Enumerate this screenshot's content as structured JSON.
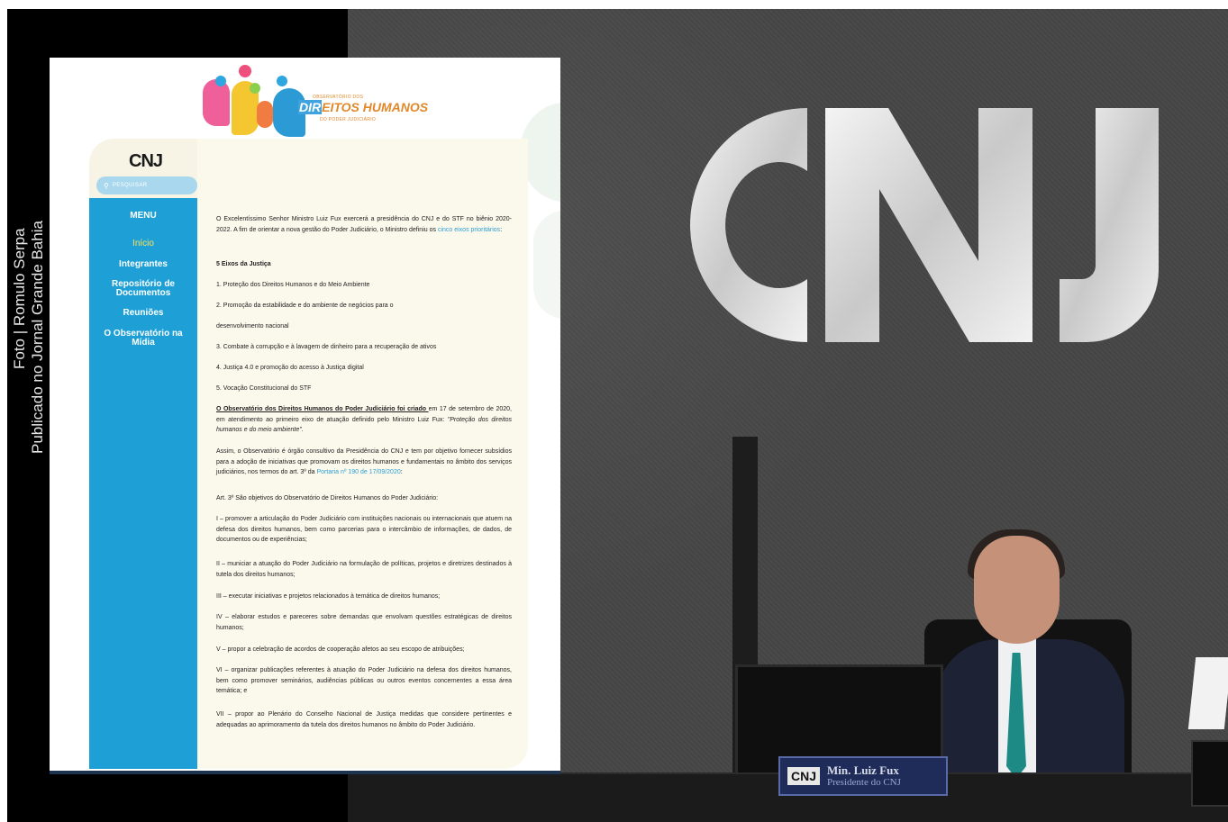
{
  "credit": {
    "line1": "Foto | Romulo Serpa",
    "line2": "Publicado no Jornal Grande Bahia"
  },
  "photo": {
    "big_logo": "CNJ",
    "nameplate_logo": "CNJ",
    "nameplate_name": "Min. Luiz Fux",
    "nameplate_role": "Presidente do CNJ"
  },
  "site": {
    "logo": {
      "top_text": "OBSERVATÓRIO DOS",
      "main_text_a": "DIR",
      "main_text_b": "EITOS HUMANOS",
      "bottom_text": "DO PODER JUDICIÁRIO"
    },
    "cnj_logo": "CNJ",
    "search": {
      "icon": "search-icon",
      "placeholder": "PESQUISAR"
    },
    "menu": {
      "title": "MENU",
      "items": [
        {
          "label": "Início",
          "active": true
        },
        {
          "label": "Integrantes"
        },
        {
          "label": "Repositório de"
        },
        {
          "label": "Documentos"
        },
        {
          "label": "Reuniões"
        },
        {
          "label": "O Observatório na"
        },
        {
          "label": "Mídia"
        }
      ]
    },
    "content": {
      "intro_a": "O Excelentíssimo Senhor Ministro Luiz Fux exercerá a presidência do CNJ e do STF no biênio 2020-2022. A fim de orientar a nova gestão do Poder Judiciário, o Ministro definiu os ",
      "intro_link": "cinco eixos prioritários",
      "intro_b": ":",
      "eixos_title": "5 Eixos da Justiça",
      "eixo1": "1. Proteção dos Direitos Humanos e do Meio Ambiente",
      "eixo2a": "2. Promoção da estabilidade e do ambiente de negócios para o",
      "eixo2b": "desenvolvimento nacional",
      "eixo3": "3. Combate à corrupção e à lavagem de dinheiro para a recuperação de ativos",
      "eixo4": "4. Justiça 4.0 e promoção do acesso à Justiça digital",
      "eixo5": "5. Vocação Constitucional do STF",
      "created_bold": "O Observatório dos Direitos Humanos do Poder Judiciário foi criado ",
      "created_rest": "em 17 de setembro de 2020, em atendimento ao primeiro eixo de atuação definido pelo Ministro Luiz Fux: ",
      "created_quote": "\"Proteção dos direitos humanos e do meio ambiente\".",
      "assim_a": "Assim, o Observatório é órgão consultivo da Presidência do CNJ e tem por objetivo fornecer subsídios para a adoção de iniciativas que promovam os direitos humanos e fundamentais no âmbito dos serviços judiciários, nos termos do art. 3º da ",
      "assim_link": "Portaria nº 190 de 17/09/2020",
      "assim_b": ":",
      "art3": "Art. 3º São objetivos do Observatório de Direitos Humanos do Poder Judiciário:",
      "obj1": "I – promover a articulação do Poder Judiciário com instituições nacionais ou internacionais que atuem na defesa dos direitos humanos, bem como parcerias para o intercâmbio de informações, de dados, de documentos ou de experiências;",
      "obj2": "II – municiar a atuação do Poder Judiciário na formulação de políticas, projetos e diretrizes destinados à tutela dos direitos humanos;",
      "obj3": "III – executar iniciativas e projetos relacionados à temática de direitos humanos;",
      "obj4": "IV – elaborar estudos e pareceres sobre demandas que envolvam questões estratégicas de direitos humanos;",
      "obj5": "V – propor a celebração de acordos de cooperação afetos ao seu escopo de atribuições;",
      "obj6": "VI – organizar publicações referentes à atuação do Poder Judiciário na defesa dos direitos humanos, bem como promover seminários, audiências públicas ou outros eventos concernentes a essa área temática; e",
      "obj7": "VII – propor ao Plenário do Conselho Nacional de Justiça medidas que considere pertinentes e adequadas ao aprimoramento da tutela dos direitos humanos no âmbito do Poder Judiciário."
    }
  }
}
